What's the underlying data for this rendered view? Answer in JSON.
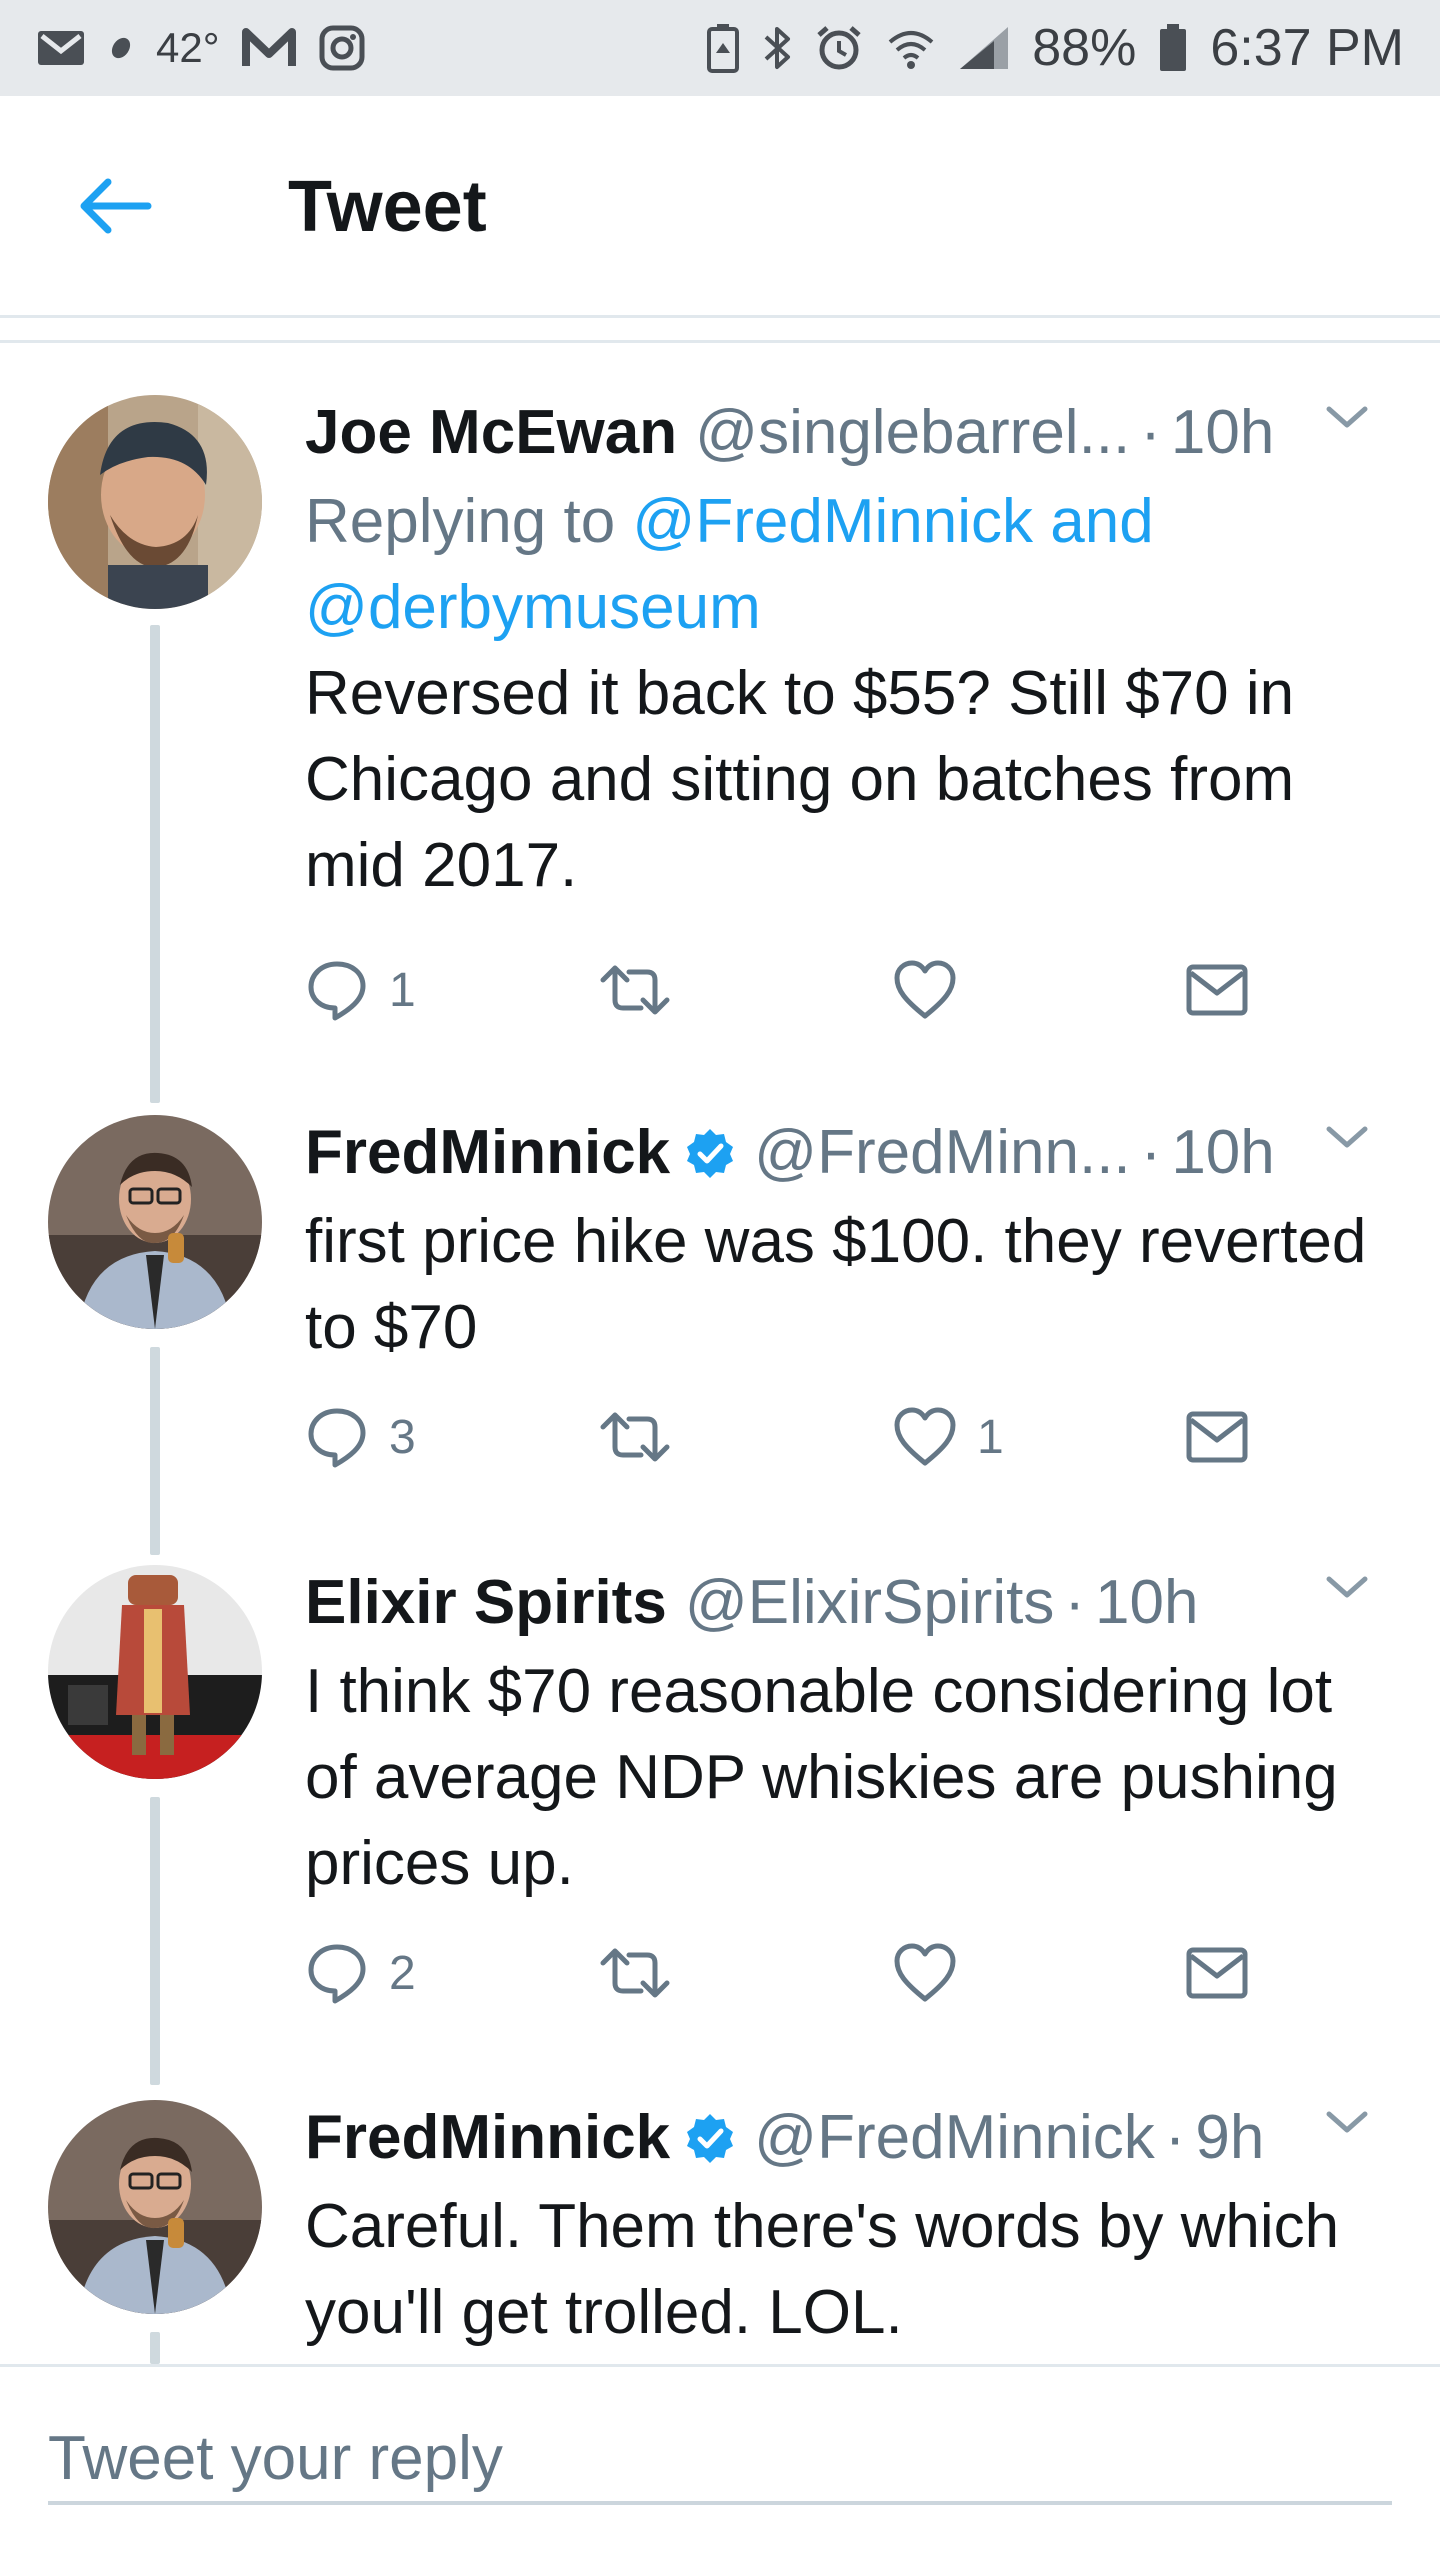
{
  "statusbar": {
    "temperature": "42°",
    "battery": "88%",
    "time": "6:37 PM"
  },
  "header": {
    "title": "Tweet"
  },
  "colors": {
    "accent": "#1da1f2",
    "secondary_text": "#657786",
    "verified": "#1da1f2"
  },
  "tweets": [
    {
      "name": "Joe McEwan",
      "handle": "@singlebarrel...",
      "time": "10h",
      "replying_prefix": "Replying to ",
      "replying_link": "@FredMinnick and @derbymuseum",
      "text": "Reversed it back to $55? Still $70 in Chicago and sitting on batches from mid 2017.",
      "reply_count": "1",
      "retweet_count": "",
      "like_count": "",
      "verified": false
    },
    {
      "name": "FredMinnick",
      "handle": "@FredMinn...",
      "time": "10h",
      "text": "first price hike was $100. they reverted to $70",
      "reply_count": "3",
      "retweet_count": "",
      "like_count": "1",
      "verified": true
    },
    {
      "name": "Elixir Spirits",
      "handle": "@ElixirSpirits",
      "time": "10h",
      "text": "I think $70 reasonable considering lot of  average NDP whiskies are pushing prices up.",
      "reply_count": "2",
      "retweet_count": "",
      "like_count": "",
      "verified": false
    },
    {
      "name": "FredMinnick",
      "handle": "@FredMinnick",
      "time": "9h",
      "text": "Careful. Them there's words by which you'll get trolled. LOL.",
      "verified": true
    }
  ],
  "reply_box": {
    "placeholder": "Tweet your reply"
  }
}
